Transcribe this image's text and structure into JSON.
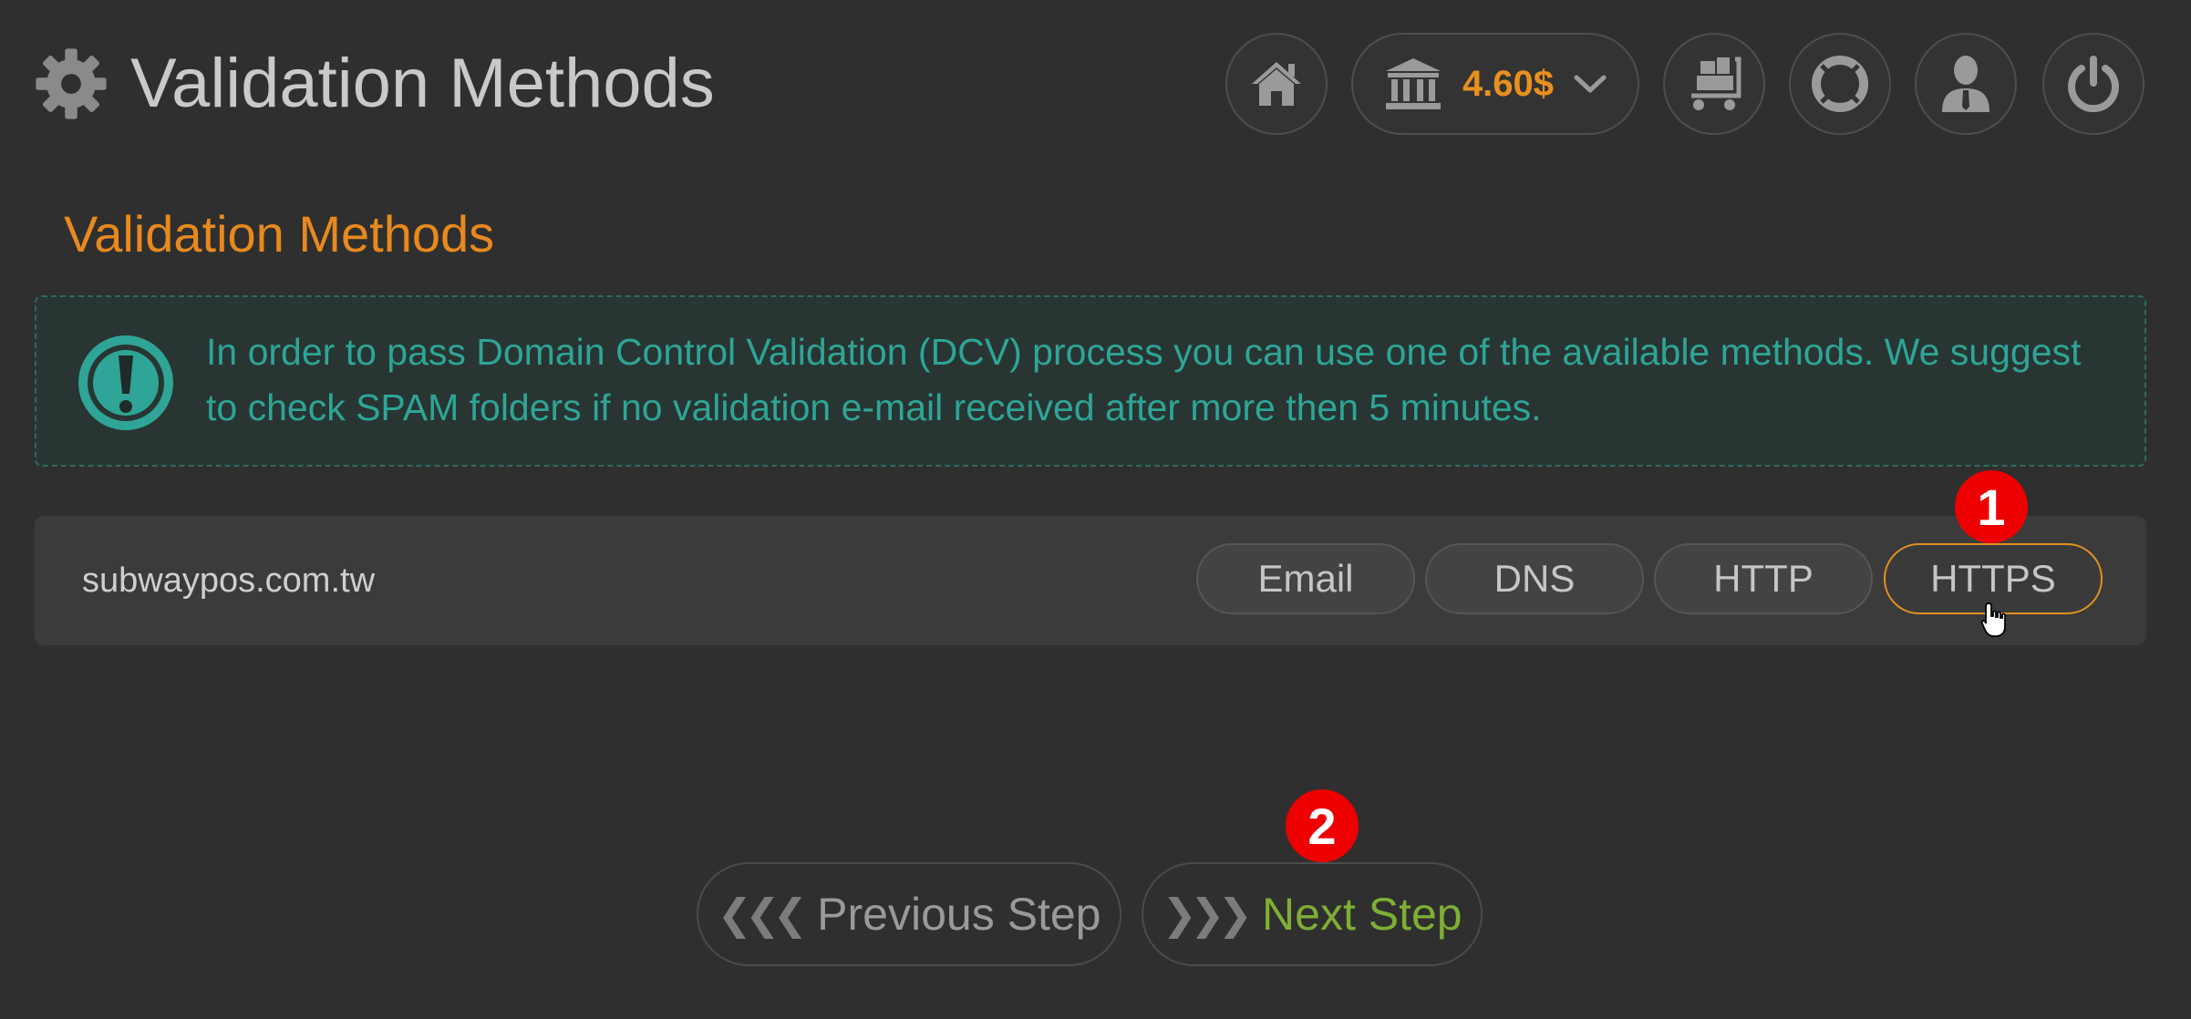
{
  "header": {
    "title": "Validation Methods",
    "balance": "4.60$",
    "icons": [
      "gear-icon",
      "home-icon",
      "bank-icon",
      "chevron-down-icon",
      "cart-icon",
      "lifebuoy-icon",
      "user-icon",
      "power-icon"
    ]
  },
  "section": {
    "title": "Validation Methods"
  },
  "alert": {
    "icon": "exclamation-icon",
    "text": "In order to pass Domain Control Validation (DCV) process you can use one of the available methods. We suggest to check SPAM folders if no validation e-mail received after more then 5 minutes."
  },
  "domain": {
    "name": "subwaypos.com.tw",
    "methods": [
      "Email",
      "DNS",
      "HTTP",
      "HTTPS"
    ],
    "selected": "HTTPS"
  },
  "badges": [
    "1",
    "2"
  ],
  "steps": {
    "previous_label": "Previous Step",
    "next_label": "Next Step",
    "previous_icon": "triple-chevron-left-icon",
    "next_icon": "triple-chevron-right-icon"
  },
  "colors": {
    "accent_orange": "#e8891e",
    "info_teal": "#2ea596",
    "next_green": "#7fae35",
    "badge_red": "#ee0000",
    "background": "#2f2f2f"
  }
}
